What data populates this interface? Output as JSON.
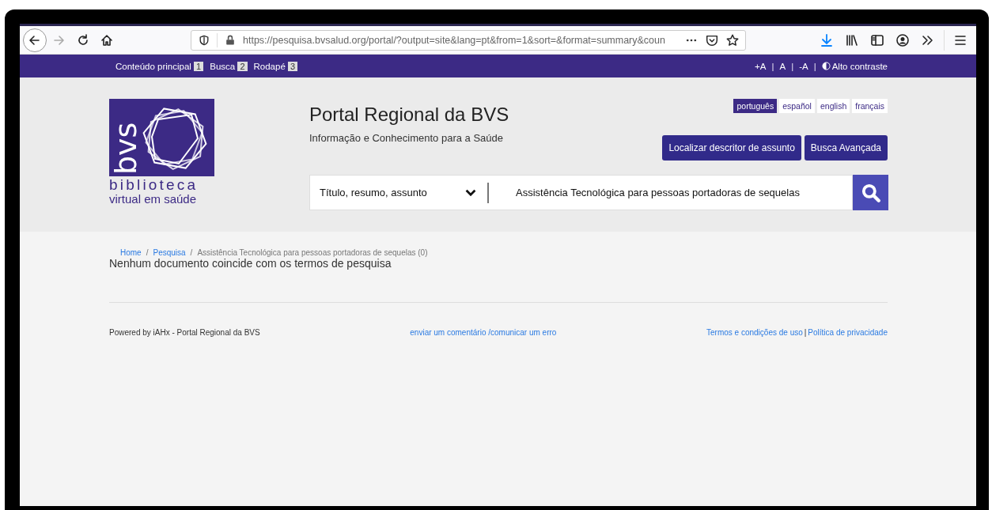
{
  "browser": {
    "nav_buttons": [
      {
        "kind": "back",
        "disabled": false
      },
      {
        "kind": "forward",
        "disabled": true
      },
      {
        "kind": "reload",
        "disabled": false
      },
      {
        "kind": "home",
        "disabled": false
      }
    ],
    "url": "https://pesquisa.bvsalud.org/portal/?output=site&lang=pt&from=1&sort=&format=summary&coun",
    "tools": [
      {
        "kind": "download"
      },
      {
        "kind": "library"
      },
      {
        "kind": "sidebar"
      },
      {
        "kind": "account"
      },
      {
        "kind": "overflow"
      },
      {
        "kind": "menu"
      }
    ]
  },
  "access_bar": {
    "skip_links": [
      {
        "label": "Conteúdo principal",
        "key": "1"
      },
      {
        "label": "Busca",
        "key": "2"
      },
      {
        "label": "Rodapé",
        "key": "3"
      }
    ],
    "font_controls": [
      {
        "kind": "link",
        "text": "+A"
      },
      {
        "kind": "separator",
        "text": "|"
      },
      {
        "kind": "link",
        "text": "A"
      },
      {
        "kind": "separator",
        "text": "|"
      },
      {
        "kind": "link",
        "text": "-A"
      },
      {
        "kind": "separator",
        "text": "|"
      }
    ],
    "contrast": "Alto contraste"
  },
  "header": {
    "logo": {
      "mark": "bvs",
      "line1": "biblioteca",
      "line2": "virtual em saúde"
    },
    "title": "Portal Regional da BVS",
    "subtitle": "Informação e Conhecimento para a Saúde",
    "languages": [
      {
        "label": "português",
        "selected": true
      },
      {
        "label": "español",
        "selected": false
      },
      {
        "label": "english",
        "selected": false
      },
      {
        "label": "français",
        "selected": false
      }
    ],
    "buttons": [
      "Localizar descritor de assunto",
      "Busca Avançada"
    ],
    "search": {
      "scope": "Título, resumo, assunto",
      "value": "Assistência Tecnológica para pessoas portadoras de sequelas"
    }
  },
  "breadcrumb": [
    {
      "label": "Home",
      "link": true
    },
    {
      "label": "Pesquisa",
      "link": true
    },
    {
      "label": "Assistência Tecnológica para pessoas portadoras de sequelas (0)",
      "link": false
    }
  ],
  "breadcrumb_separator": "/",
  "message": "Nenhum documento coincide com os termos de pesquisa",
  "footer": {
    "powered": "Powered by iAHx - Portal Regional da BVS",
    "feedback": "enviar um comentário /comunicar um erro",
    "links": [
      "Termos e condições de uso",
      "Política de privacidade"
    ],
    "links_separator": "|"
  }
}
